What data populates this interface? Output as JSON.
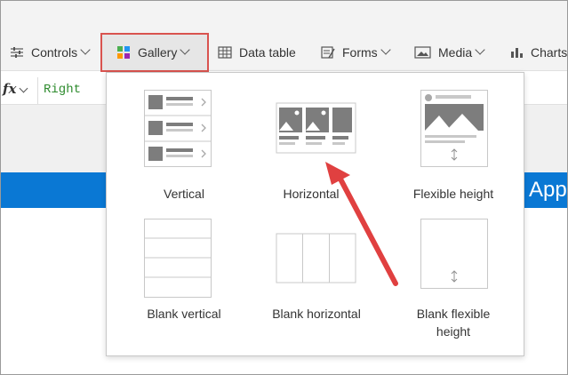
{
  "toolbar": {
    "items": [
      {
        "label": "Controls",
        "icon": "controls-icon"
      },
      {
        "label": "Gallery",
        "icon": "gallery-icon"
      },
      {
        "label": "Data table",
        "icon": "data-table-icon"
      },
      {
        "label": "Forms",
        "icon": "forms-icon"
      },
      {
        "label": "Media",
        "icon": "media-icon"
      },
      {
        "label": "Charts",
        "icon": "charts-icon"
      }
    ]
  },
  "formula_bar": {
    "fx": "fx",
    "value": "Right"
  },
  "canvas": {
    "banner_text": "App"
  },
  "gallery_menu": {
    "options": [
      {
        "label": "Vertical"
      },
      {
        "label": "Horizontal"
      },
      {
        "label": "Flexible height"
      },
      {
        "label": "Blank vertical"
      },
      {
        "label": "Blank horizontal"
      },
      {
        "label": "Blank flexible height"
      }
    ]
  },
  "colors": {
    "accent_blue": "#0a78d4",
    "highlight_red": "#d9534f",
    "arrow_red": "#e04040",
    "formula_green": "#2e8b2e"
  }
}
